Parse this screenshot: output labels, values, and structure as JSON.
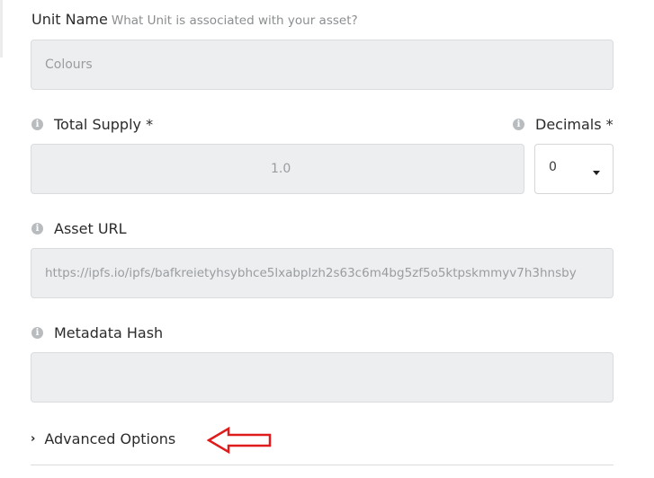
{
  "unit_name": {
    "label": "Unit Name",
    "hint": "What Unit is associated with your asset?",
    "value": "Colours"
  },
  "total_supply": {
    "label": "Total Supply *",
    "value": "1.0"
  },
  "decimals": {
    "label": "Decimals *",
    "value": "0"
  },
  "asset_url": {
    "label": "Asset URL",
    "value": "https://ipfs.io/ipfs/bafkreietyhsybhce5lxabplzh2s63c6m4bg5zf5o5ktpskmmyv7h3hnsby"
  },
  "metadata_hash": {
    "label": "Metadata Hash",
    "value": ""
  },
  "advanced": {
    "label": "Advanced Options"
  },
  "icons": {
    "info": "i",
    "chevron": "›"
  },
  "colors": {
    "annotation_arrow": "#e01b1b",
    "field_background": "#eceeef"
  }
}
